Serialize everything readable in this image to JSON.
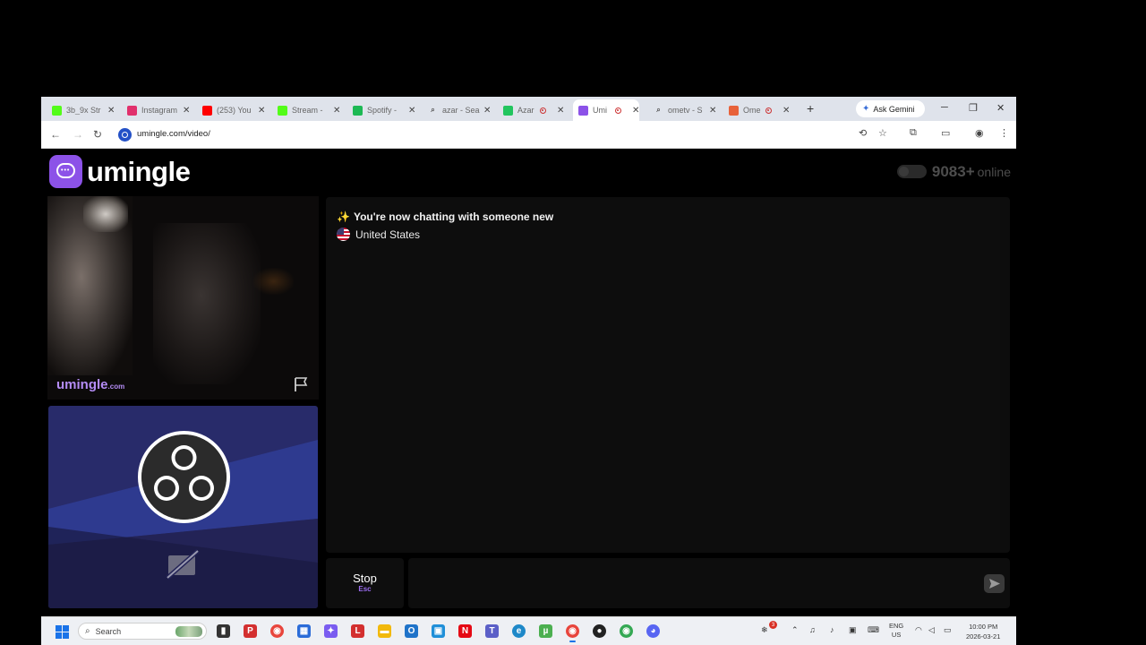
{
  "browser": {
    "tabs": [
      {
        "title": "3b_9x Str",
        "icon": "kick-icon",
        "color": "#53fc18"
      },
      {
        "title": "Instagram",
        "icon": "instagram-icon",
        "color": "#e1306c"
      },
      {
        "title": "(253) You",
        "icon": "youtube-icon",
        "color": "#ff0000"
      },
      {
        "title": "Stream - ",
        "icon": "kick-icon",
        "color": "#53fc18"
      },
      {
        "title": "Spotify - ",
        "icon": "spotify-icon",
        "color": "#1db954"
      },
      {
        "title": "azar - Sea",
        "icon": "search-icon",
        "color": "#555555"
      },
      {
        "title": "Azar",
        "icon": "azar-icon",
        "color": "#22c55e",
        "recording": true
      },
      {
        "title": "Umi",
        "icon": "umingle-icon",
        "color": "#8c52e8",
        "recording": true,
        "active": true
      },
      {
        "title": "ometv - S",
        "icon": "search-icon",
        "color": "#555555"
      },
      {
        "title": "Ome",
        "icon": "ome-icon",
        "color": "#e8623a",
        "recording": true
      }
    ],
    "new_tab": "+",
    "gemini_label": "Ask Gemini",
    "window_controls": {
      "minimize": "─",
      "restore": "❐",
      "close": "✕"
    },
    "url": "umingle.com/video/"
  },
  "page": {
    "logo_text": "umingle",
    "online_count": "9083+",
    "online_label": "online",
    "watermark_main": "umingle",
    "watermark_suffix": ".com",
    "chat": {
      "message_emoji": "✨",
      "message": "You're now chatting with someone new",
      "country": "United States"
    },
    "stop_label": "Stop",
    "stop_key": "Esc",
    "input_placeholder": ""
  },
  "taskbar": {
    "search_placeholder": "Search",
    "apps": [
      {
        "name": "task-view-icon",
        "glyph": "▮",
        "color": "#333333"
      },
      {
        "name": "pdf-app-icon",
        "glyph": "P",
        "color": "#d32f2f"
      },
      {
        "name": "chrome-icon",
        "glyph": "◉",
        "color": "#e8453c"
      },
      {
        "name": "calculator-icon",
        "glyph": "▦",
        "color": "#2b6cd8"
      },
      {
        "name": "copilot-icon",
        "glyph": "✦",
        "color": "#7a5cf0"
      },
      {
        "name": "lenovo-icon",
        "glyph": "L",
        "color": "#d32f2f"
      },
      {
        "name": "file-explorer-icon",
        "glyph": "▬",
        "color": "#f2b90c"
      },
      {
        "name": "outlook-icon",
        "glyph": "O",
        "color": "#1f73c9"
      },
      {
        "name": "store-icon",
        "glyph": "▣",
        "color": "#1f8fd8"
      },
      {
        "name": "netflix-icon",
        "glyph": "N",
        "color": "#e50914"
      },
      {
        "name": "teams-icon",
        "glyph": "T",
        "color": "#5b5fc7"
      },
      {
        "name": "edge-icon",
        "glyph": "e",
        "color": "#1e88c8"
      },
      {
        "name": "utorrent-icon",
        "glyph": "µ",
        "color": "#4caf50"
      },
      {
        "name": "chrome-active-icon",
        "glyph": "◉",
        "color": "#e8453c"
      },
      {
        "name": "obs-icon",
        "glyph": "●",
        "color": "#222222"
      },
      {
        "name": "chrome-profile-icon",
        "glyph": "◉",
        "color": "#34a853"
      },
      {
        "name": "discord-icon",
        "glyph": "◕",
        "color": "#5865f2"
      }
    ],
    "weather_badge": "3",
    "lang_line1": "ENG",
    "lang_line2": "US",
    "time": "10:00 PM",
    "date": "2026-03-21"
  }
}
